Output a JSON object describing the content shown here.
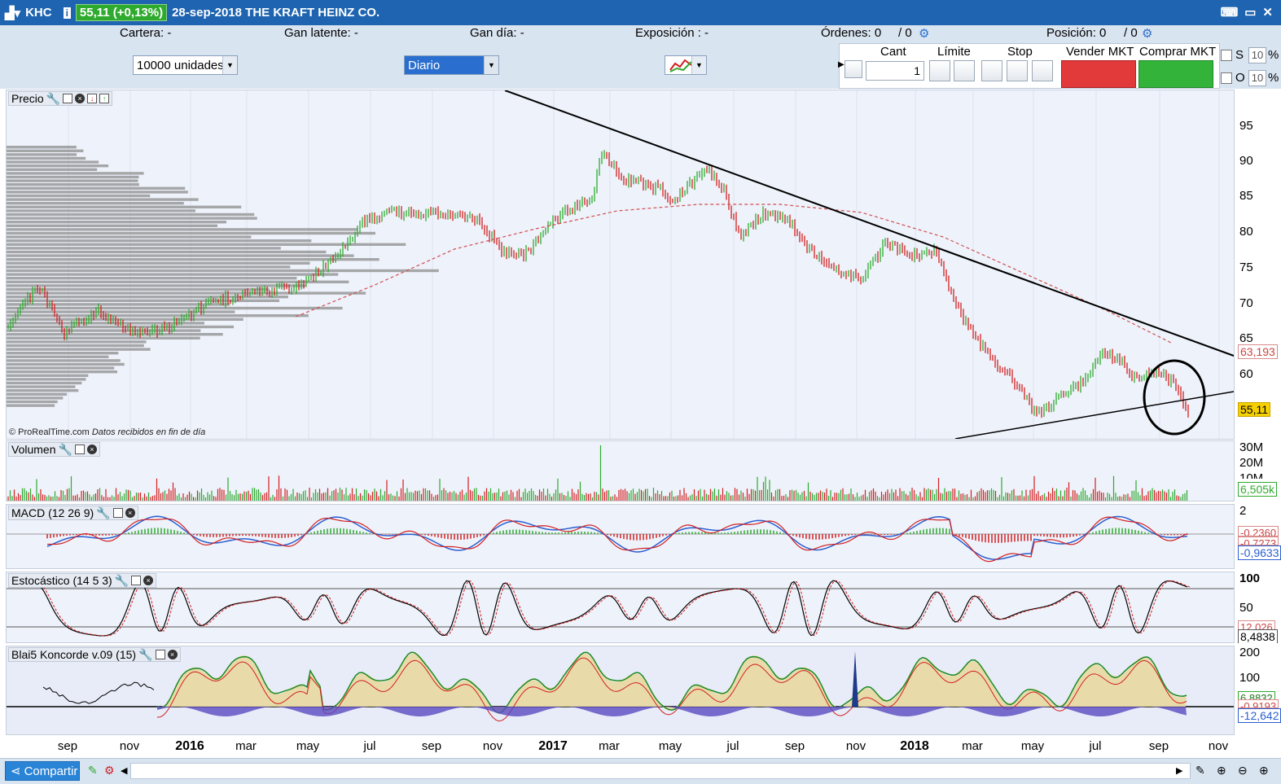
{
  "titlebar": {
    "ticker": "KHC",
    "price_badge": "55,11 (+0,13%)",
    "date_name": "28-sep-2018 THE KRAFT HEINZ CO."
  },
  "inforow": {
    "cartera": "Cartera: -",
    "gan_latente": "Gan latente: -",
    "gan_dia": "Gan día: -",
    "exposicion": "Exposición : -",
    "ordenes": "Órdenes: 0",
    "ordenes_sep": "/ 0",
    "posicion": "Posición: 0",
    "posicion_sep": "/ 0"
  },
  "toolbar": {
    "units_select": "10000 unidades",
    "period_select": "Diario",
    "order": {
      "cant_label": "Cant",
      "cant_value": "1",
      "limite_label": "Límite",
      "stop_label": "Stop",
      "sell_label": "Vender MKT",
      "buy_label": "Comprar MKT",
      "s_label": "S",
      "o_label": "O",
      "s_value": "10",
      "o_value": "10",
      "pct": "%"
    }
  },
  "panels": {
    "price": {
      "title": "Precio",
      "copyright": "© ProRealTime.com",
      "copyright_note": "Datos recibidos en fin de día",
      "ticks": [
        "95",
        "90",
        "85",
        "80",
        "75",
        "70",
        "65",
        "60"
      ],
      "tag_ma": "63,193",
      "tag_price": "55,11"
    },
    "volume": {
      "title": "Volumen",
      "ticks": [
        "30M",
        "20M",
        "10M"
      ],
      "tag": "6,505k"
    },
    "macd": {
      "title": "MACD (12 26 9)",
      "ticks": [
        "2"
      ],
      "tag1": "-0,2360",
      "tag2": "-0,7273",
      "tag3": "-0,9633"
    },
    "stoch": {
      "title": "Estocástico (14 5 3)",
      "ticks": [
        "100",
        "50"
      ],
      "tag1": "12,026",
      "tag2": "8,4838"
    },
    "koncorde": {
      "title": "Blai5 Koncorde v.09 (15)",
      "ticks": [
        "200",
        "100"
      ],
      "tag1": "6,8832",
      "tag2": "-0,9193",
      "tag3": "-12,642"
    }
  },
  "xaxis": {
    "labels": [
      "sep",
      "nov",
      "2016",
      "mar",
      "may",
      "jul",
      "sep",
      "nov",
      "2017",
      "mar",
      "may",
      "jul",
      "sep",
      "nov",
      "2018",
      "mar",
      "may",
      "jul",
      "sep",
      "nov"
    ]
  },
  "statusbar": {
    "share_label": "Compartir"
  },
  "colors": {
    "titlebar": "#1e64b0",
    "up": "#2eaa2e",
    "down": "#d22020",
    "panel_bg": "#eef2fb"
  }
}
